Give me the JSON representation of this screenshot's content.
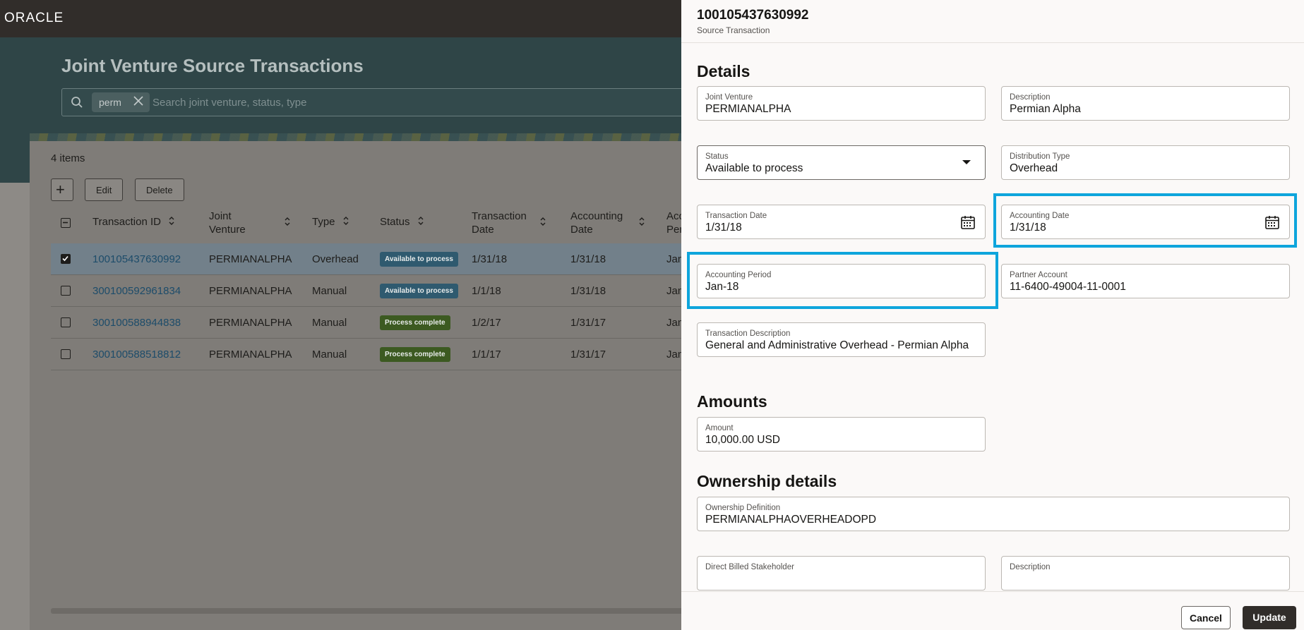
{
  "header": {
    "logo": "ORACLE"
  },
  "page": {
    "title": "Joint Venture Source Transactions",
    "search": {
      "chip": "perm",
      "placeholder": "Search joint venture, status, type"
    },
    "items_count": "4 items",
    "toolbar": {
      "add_label": "+",
      "edit_label": "Edit",
      "delete_label": "Delete"
    },
    "columns": [
      "Transaction ID",
      "Joint Venture",
      "Type",
      "Status",
      "Transaction Date",
      "Accounting Date",
      "Acc Per"
    ],
    "rows": [
      {
        "id": "100105437630992",
        "jv": "PERMIANALPHA",
        "type": "Overhead",
        "status": "Available to process",
        "tdate": "1/31/18",
        "adate": "1/31/18",
        "period": "Jan",
        "selected": true
      },
      {
        "id": "300100592961834",
        "jv": "PERMIANALPHA",
        "type": "Manual",
        "status": "Available to process",
        "tdate": "1/1/18",
        "adate": "1/31/18",
        "period": "Jan",
        "selected": false
      },
      {
        "id": "300100588944838",
        "jv": "PERMIANALPHA",
        "type": "Manual",
        "status": "Process complete",
        "tdate": "1/2/17",
        "adate": "1/31/17",
        "period": "Jan",
        "selected": false
      },
      {
        "id": "300100588518812",
        "jv": "PERMIANALPHA",
        "type": "Manual",
        "status": "Process complete",
        "tdate": "1/1/17",
        "adate": "1/31/17",
        "period": "Jan",
        "selected": false
      }
    ]
  },
  "drawer": {
    "record_id": "100105437630992",
    "record_subtitle": "Source Transaction",
    "details_title": "Details",
    "fields": {
      "joint_venture": {
        "label": "Joint Venture",
        "value": "PERMIANALPHA"
      },
      "description": {
        "label": "Description",
        "value": "Permian Alpha"
      },
      "status": {
        "label": "Status",
        "value": "Available to process"
      },
      "distribution_type": {
        "label": "Distribution Type",
        "value": "Overhead"
      },
      "transaction_date": {
        "label": "Transaction Date",
        "value": "1/31/18"
      },
      "accounting_date": {
        "label": "Accounting Date",
        "value": "1/31/18"
      },
      "accounting_period": {
        "label": "Accounting Period",
        "value": "Jan-18"
      },
      "partner_account": {
        "label": "Partner Account",
        "value": "11-6400-49004-11-0001"
      },
      "transaction_description": {
        "label": "Transaction Description",
        "value": "General and Administrative Overhead - Permian Alpha"
      },
      "amount": {
        "label": "Amount",
        "value": "10,000.00 USD"
      },
      "ownership_definition": {
        "label": "Ownership Definition",
        "value": "PERMIANALPHAOVERHEADOPD"
      },
      "direct_billed_stakeholder": {
        "label": "Direct Billed Stakeholder",
        "value": ""
      },
      "stakeholder_description": {
        "label": "Description",
        "value": ""
      }
    },
    "amounts_title": "Amounts",
    "ownership_title": "Ownership details",
    "footer": {
      "cancel_label": "Cancel",
      "update_label": "Update"
    }
  },
  "colors": {
    "highlight": "#0ea5dc",
    "badge_available": "#2f5a6f",
    "badge_complete": "#3c5a21"
  }
}
